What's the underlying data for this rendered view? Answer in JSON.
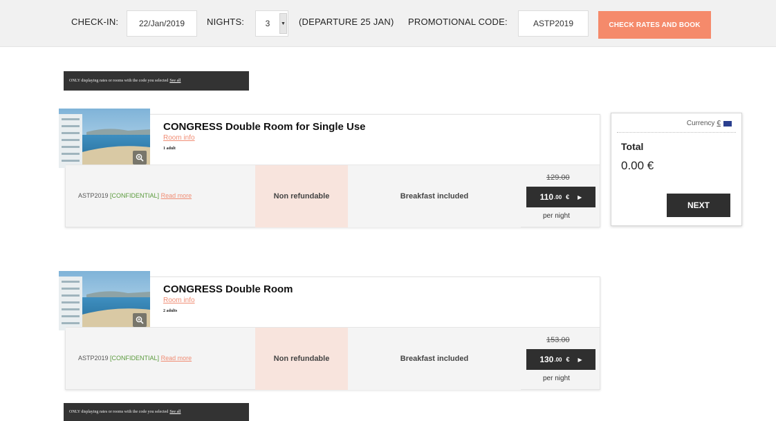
{
  "booking_bar": {
    "checkin_label": "CHECK-IN:",
    "checkin_value": "22/Jan/2019",
    "nights_label": "NIGHTS:",
    "nights_value": "3",
    "departure_text": "(DEPARTURE 25 JAN)",
    "promo_label": "PROMOTIONAL CODE:",
    "promo_value": "ASTP2019",
    "book_button": "CHECK RATES AND BOOK"
  },
  "notice": {
    "text": "ONLY displaying rates or rooms with the code you selected",
    "see_all": "See all"
  },
  "rooms": [
    {
      "title": "CONGRESS Double Room for Single Use",
      "room_info": "Room info",
      "adults": "1 adult",
      "rate": {
        "code": "ASTP2019",
        "confidential": "[CONFIDENTIAL]",
        "read_more": "Read more",
        "policy": "Non refundable",
        "board": "Breakfast included",
        "old_price": "129.00",
        "price_int": "110",
        "price_dec": ".00",
        "currency": "€",
        "per_night": "per night"
      }
    },
    {
      "title": "CONGRESS Double Room",
      "room_info": "Room info",
      "adults": "2 adults",
      "rate": {
        "code": "ASTP2019",
        "confidential": "[CONFIDENTIAL]",
        "read_more": "Read more",
        "policy": "Non refundable",
        "board": "Breakfast included",
        "old_price": "153.00",
        "price_int": "130",
        "price_dec": ".00",
        "currency": "€",
        "per_night": "per night"
      }
    }
  ],
  "summary": {
    "currency_label": "Currency",
    "currency_symbol": "€",
    "total_label": "Total",
    "total_value": "0.00 €",
    "next_button": "NEXT"
  },
  "icons": {
    "nights_dropdown": "chevron-down-icon",
    "zoom": "zoom-in-icon",
    "price_arrow": "caret-right-icon",
    "flag": "flag-icon"
  },
  "colors": {
    "accent": "#f58a6b",
    "dark": "#2f2f2f",
    "nonrefundable_bg": "#f8e4dd",
    "confidential": "#5a9a3c",
    "link": "#f08c73"
  }
}
